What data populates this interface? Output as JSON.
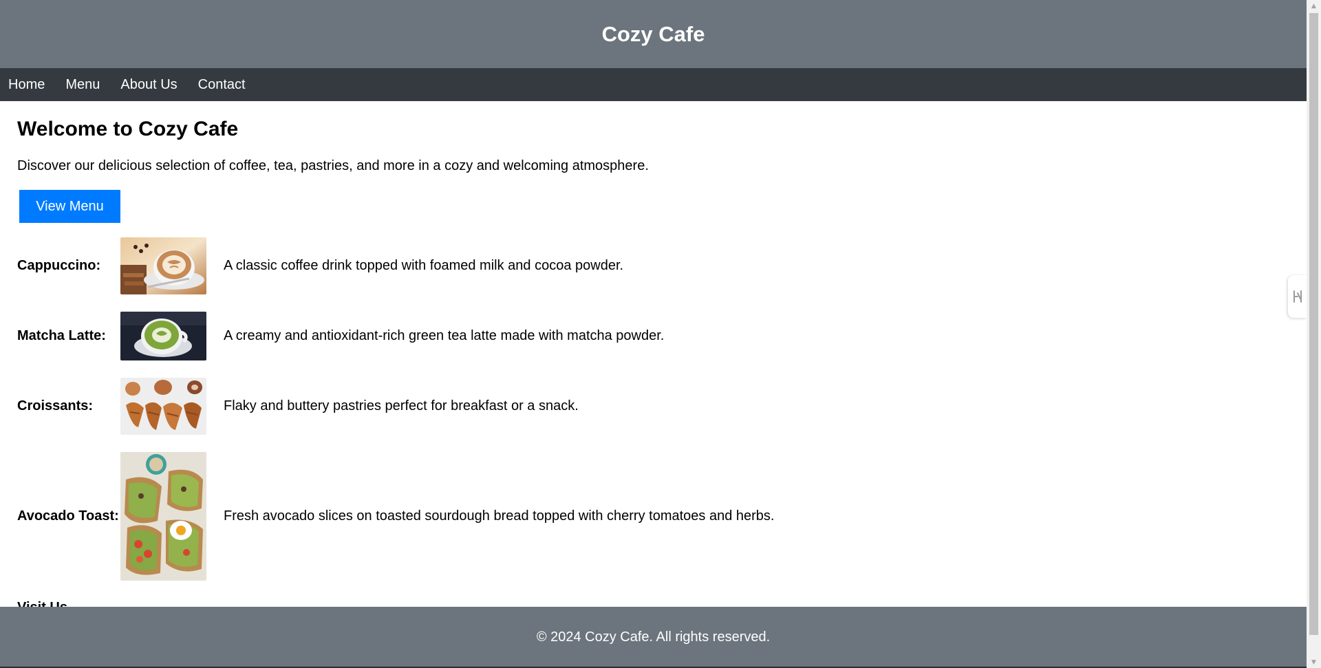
{
  "header": {
    "title": "Cozy Cafe"
  },
  "nav": {
    "items": [
      {
        "label": "Home"
      },
      {
        "label": "Menu"
      },
      {
        "label": "About Us"
      },
      {
        "label": "Contact"
      }
    ]
  },
  "main": {
    "heading": "Welcome to Cozy Cafe",
    "intro": "Discover our delicious selection of coffee, tea, pastries, and more in a cozy and welcoming atmosphere.",
    "view_menu_label": "View Menu",
    "menu_items": [
      {
        "name": "Cappuccino:",
        "description": "A classic coffee drink topped with foamed milk and cocoa powder."
      },
      {
        "name": "Matcha Latte:",
        "description": "A creamy and antioxidant-rich green tea latte made with matcha powder."
      },
      {
        "name": "Croissants:",
        "description": "Flaky and buttery pastries perfect for breakfast or a snack."
      },
      {
        "name": "Avocado Toast:",
        "description": "Fresh avocado slices on toasted sourdough bread topped with cherry tomatoes and herbs."
      }
    ],
    "partial_heading": "Visit Us"
  },
  "footer": {
    "text": "© 2024 Cozy Cafe. All rights reserved."
  },
  "colors": {
    "header_bg": "#6c757d",
    "nav_bg": "#343a40",
    "button_bg": "#007bff",
    "footer_bg": "#6c757d"
  }
}
